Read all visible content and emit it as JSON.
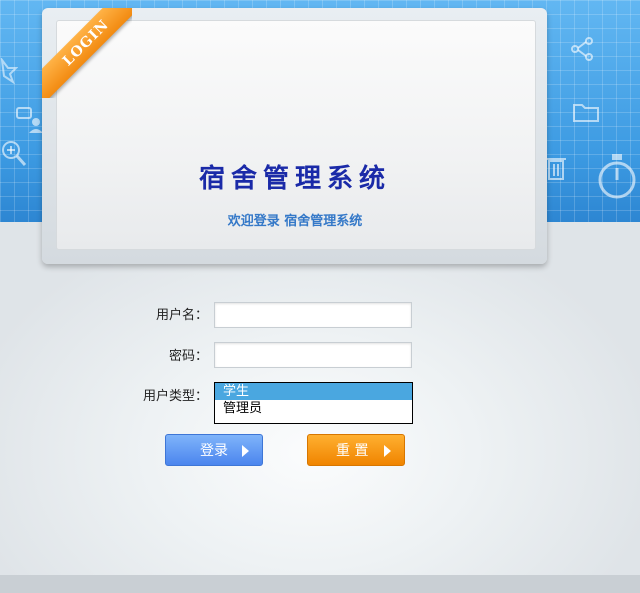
{
  "header": {
    "ribbon_label": "LOGIN",
    "title": "宿舍管理系统",
    "subtitle": "欢迎登录 宿舍管理系统"
  },
  "form": {
    "username_label": "用户名：",
    "username_value": "",
    "password_label": "密码：",
    "password_value": "",
    "usertype_label": "用户类型：",
    "usertype_options": [
      "学生",
      "管理员"
    ],
    "usertype_selected": "学生"
  },
  "buttons": {
    "login_label": "登录",
    "reset_label": "重 置"
  },
  "colors": {
    "banner_blue": "#3f9fe6",
    "title_blue": "#1a2aa8",
    "subtitle_blue": "#3478c8",
    "ribbon_orange": "#f28a10",
    "login_button": "#4b85ee",
    "reset_button": "#f08400",
    "selected_option": "#4aa7e0"
  },
  "icons": [
    "star-icon",
    "chat-user-icon",
    "zoom-in-icon",
    "share-icon",
    "folder-icon",
    "trash-icon",
    "stopwatch-icon",
    "chevron-right-icon"
  ]
}
